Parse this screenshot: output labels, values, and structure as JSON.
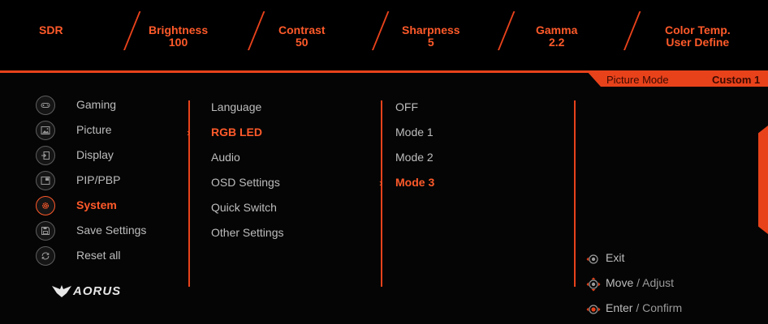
{
  "top": {
    "mode": "SDR",
    "brightness_label": "Brightness",
    "brightness_value": "100",
    "contrast_label": "Contrast",
    "contrast_value": "50",
    "sharpness_label": "Sharpness",
    "sharpness_value": "5",
    "gamma_label": "Gamma",
    "gamma_value": "2.2",
    "color_temp_label": "Color Temp.",
    "color_temp_value": "User Define"
  },
  "header": {
    "picture_mode_label": "Picture Mode",
    "picture_mode_value": "Custom 1"
  },
  "menu": {
    "items": [
      {
        "label": "Gaming",
        "icon": "gamepad-icon"
      },
      {
        "label": "Picture",
        "icon": "picture-icon"
      },
      {
        "label": "Display",
        "icon": "display-input-icon"
      },
      {
        "label": "PIP/PBP",
        "icon": "pip-icon"
      },
      {
        "label": "System",
        "icon": "gear-icon",
        "active": true
      },
      {
        "label": "Save Settings",
        "icon": "save-icon"
      },
      {
        "label": "Reset all",
        "icon": "reset-icon"
      }
    ]
  },
  "submenu": {
    "items": [
      "Language",
      "RGB LED",
      "Audio",
      "OSD Settings",
      "Quick Switch",
      "Other Settings"
    ],
    "selected": "RGB LED"
  },
  "options": {
    "items": [
      "OFF",
      "Mode 1",
      "Mode 2",
      "Mode 3"
    ],
    "selected": "Mode 3"
  },
  "controls": {
    "exit": "Exit",
    "move": "Move",
    "adjust": "/ Adjust",
    "enter": "Enter",
    "confirm": "/ Confirm"
  },
  "brand": {
    "logo": "AORUS"
  },
  "colors": {
    "accent": "#e8421b",
    "accent_text": "#ff5a2a",
    "text": "#bdbdbd",
    "background": "#050505"
  }
}
